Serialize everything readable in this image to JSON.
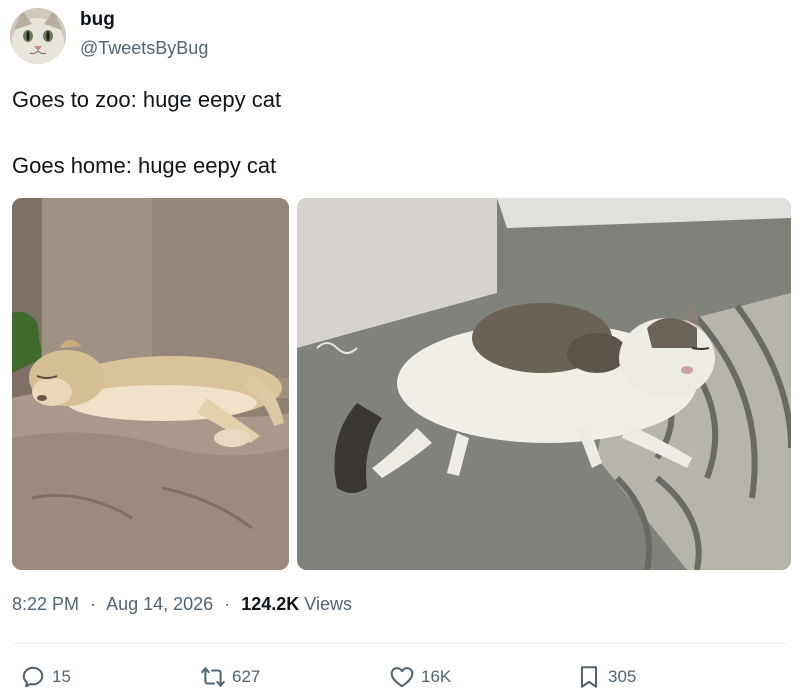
{
  "author": {
    "name": "bug",
    "handle": "@TweetsByBug",
    "avatar_icon": "cat-face-avatar"
  },
  "tweet": {
    "lines": [
      "Goes to zoo: huge eepy cat",
      "Goes home: huge eepy cat"
    ],
    "media": [
      {
        "icon": "sleeping-lioness-photo"
      },
      {
        "icon": "sleeping-cat-photo"
      }
    ]
  },
  "meta": {
    "time": "8:22 PM",
    "separator": "·",
    "date": "Aug 14, 2026",
    "views_count": "124.2K",
    "views_label": "Views"
  },
  "actions": {
    "replies": "15",
    "retweets": "627",
    "likes": "16K",
    "bookmarks": "305"
  },
  "colors": {
    "text": "#0f1419",
    "secondary": "#536471",
    "divider": "#eff3f4"
  }
}
